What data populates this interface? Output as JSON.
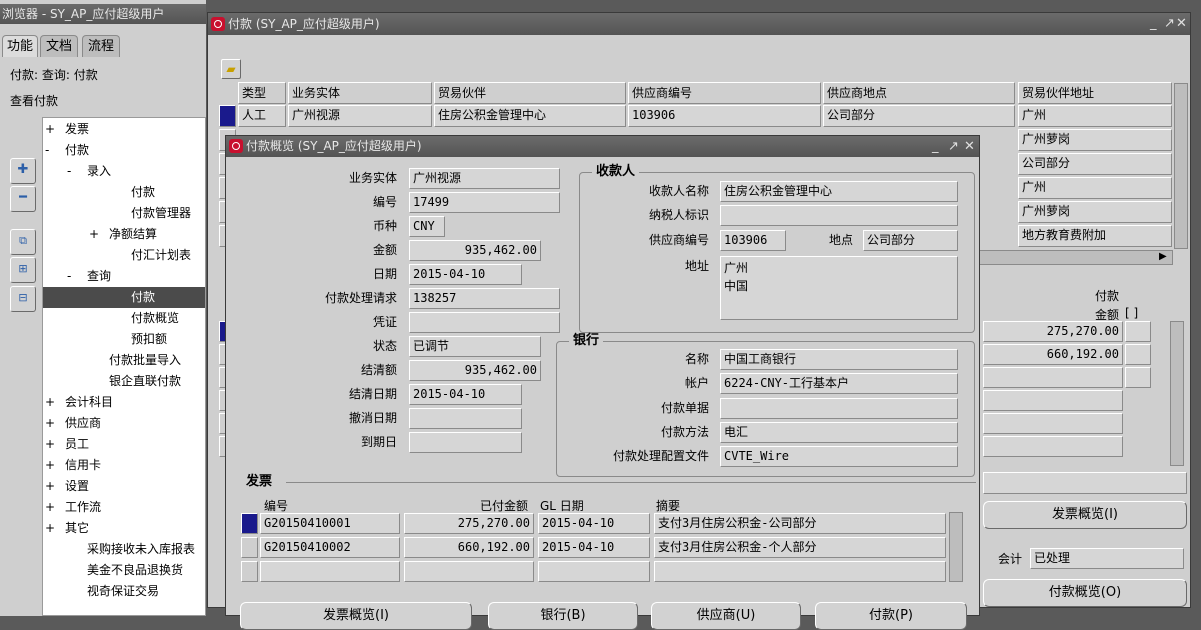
{
  "navigator": {
    "title": "浏览器 - SY_AP_应付超级用户",
    "tabs": [
      "功能",
      "文档",
      "流程"
    ],
    "breadcrumb": "付款: 查询: 付款",
    "section": "查看付款",
    "tree": [
      {
        "sign": "+",
        "label": "发票",
        "indent": 0
      },
      {
        "sign": "-",
        "label": "付款",
        "indent": 0
      },
      {
        "sign": "-",
        "label": "录入",
        "indent": 1
      },
      {
        "sign": "",
        "label": "付款",
        "indent": 3
      },
      {
        "sign": "",
        "label": "付款管理器",
        "indent": 3
      },
      {
        "sign": "+",
        "label": "净额结算",
        "indent": 2
      },
      {
        "sign": "",
        "label": "付汇计划表",
        "indent": 3
      },
      {
        "sign": "-",
        "label": "查询",
        "indent": 1
      },
      {
        "sign": "",
        "label": "付款",
        "indent": 3
      },
      {
        "sign": "",
        "label": "付款概览",
        "indent": 3
      },
      {
        "sign": "",
        "label": "预扣额",
        "indent": 3
      },
      {
        "sign": "",
        "label": "付款批量导入",
        "indent": 2
      },
      {
        "sign": "",
        "label": "银企直联付款",
        "indent": 2
      },
      {
        "sign": "+",
        "label": "会计科目",
        "indent": 0
      },
      {
        "sign": "+",
        "label": "供应商",
        "indent": 0
      },
      {
        "sign": "+",
        "label": "员工",
        "indent": 0
      },
      {
        "sign": "+",
        "label": "信用卡",
        "indent": 0
      },
      {
        "sign": "+",
        "label": "设置",
        "indent": 0
      },
      {
        "sign": "+",
        "label": "工作流",
        "indent": 0
      },
      {
        "sign": "+",
        "label": "其它",
        "indent": 0
      },
      {
        "sign": "",
        "label": "采购接收未入库报表",
        "indent": 1
      },
      {
        "sign": "",
        "label": "美金不良品退换货",
        "indent": 1
      },
      {
        "sign": "",
        "label": "视奇保证交易",
        "indent": 1
      }
    ]
  },
  "payments_window": {
    "title": "付款 (SY_AP_应付超级用户)",
    "columns": [
      "类型",
      "业务实体",
      "贸易伙伴",
      "供应商编号",
      "供应商地点",
      "贸易伙伴地址"
    ],
    "first_row": [
      "人工",
      "广州视源",
      "住房公积金管理中心",
      "103906",
      "公司部分",
      "广州"
    ],
    "address_column": [
      "广州",
      "广州萝岗",
      "公司部分",
      "广州",
      "广州萝岗",
      "地方教育费附加"
    ],
    "amount_header_line1": "付款",
    "amount_header_line2": "金额",
    "amount_header_bracket": "[ ]",
    "amounts": [
      "275,270.00",
      "660,192.00"
    ],
    "accounting_label": "会计",
    "accounting_value": "已处理",
    "invoice_overview_button": "发票概览(I)",
    "payment_overview_button": "付款概览(O)"
  },
  "overview": {
    "title": "付款概览 (SY_AP_应付超级用户)",
    "left": {
      "operating_unit_label": "业务实体",
      "operating_unit": "广州视源",
      "number_label": "编号",
      "number": "17499",
      "currency_label": "币种",
      "currency": "CNY",
      "amount_label": "金额",
      "amount": "935,462.00",
      "date_label": "日期",
      "date": "2015-04-10",
      "request_label": "付款处理请求",
      "request": "138257",
      "voucher_label": "凭证",
      "voucher": "",
      "status_label": "状态",
      "status": "已调节",
      "cleared_amount_label": "结清额",
      "cleared_amount": "935,462.00",
      "cleared_date_label": "结清日期",
      "cleared_date": "2015-04-10",
      "void_date_label": "撤消日期",
      "void_date": "",
      "maturity_label": "到期日",
      "maturity": ""
    },
    "payee": {
      "group_title": "收款人",
      "name_label": "收款人名称",
      "name": "住房公积金管理中心",
      "taxpayer_label": "纳税人标识",
      "taxpayer": "",
      "supplier_no_label": "供应商编号",
      "supplier_no": "103906",
      "site_label": "地点",
      "site": "公司部分",
      "address_label": "地址",
      "address_line1": "广州",
      "address_line2": "中国"
    },
    "bank": {
      "group_title": "银行",
      "name_label": "名称",
      "name": "中国工商银行",
      "account_label": "帐户",
      "account": "6224-CNY-工行基本户",
      "document_label": "付款单据",
      "document": "",
      "method_label": "付款方法",
      "method": "电汇",
      "profile_label": "付款处理配置文件",
      "profile": "CVTE_Wire"
    },
    "invoices": {
      "group_title": "发票",
      "col_number": "编号",
      "col_paid": "已付金额",
      "col_gl_date": "GL 日期",
      "col_desc": "摘要",
      "rows": [
        {
          "number": "G20150410001",
          "paid": "275,270.00",
          "gl_date": "2015-04-10",
          "desc": "支付3月住房公积金-公司部分"
        },
        {
          "number": "G20150410002",
          "paid": "660,192.00",
          "gl_date": "2015-04-10",
          "desc": "支付3月住房公积金-个人部分"
        },
        {
          "number": "",
          "paid": "",
          "gl_date": "",
          "desc": ""
        }
      ]
    },
    "buttons": [
      "发票概览(I)",
      "银行(B)",
      "供应商(U)",
      "付款(P)"
    ]
  }
}
